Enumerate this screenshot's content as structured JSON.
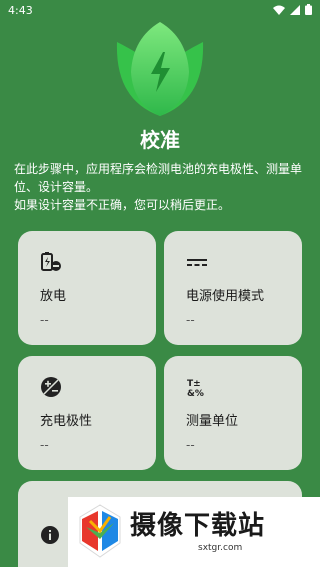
{
  "status_bar": {
    "time": "4:43",
    "icons": [
      "wifi-icon",
      "signal-icon",
      "battery-icon"
    ]
  },
  "app": {
    "logo_icon": "leaf-lightning-icon",
    "title": "校准",
    "description_line1": "在此步骤中，应用程序会检测电池的充电极性、测量单位、设计容量。",
    "description_line2": "如果设计容量不正确，您可以稍后更正。"
  },
  "cards": {
    "discharge": {
      "icon": "battery-minus-icon",
      "label": "放电",
      "value": "--"
    },
    "power_mode": {
      "icon": "dc-power-icon",
      "label": "电源使用模式",
      "value": "--"
    },
    "polarity": {
      "icon": "polarity-icon",
      "label": "充电极性",
      "value": "--"
    },
    "unit": {
      "icon": "unit-symbols-icon",
      "label": "测量单位",
      "value": "--"
    }
  },
  "info_card": {
    "icon": "info-icon"
  },
  "watermark": {
    "title": "摄像下载站",
    "url": "sxtgr.com"
  },
  "colors": {
    "background": "#3a8a45",
    "card": "#dde2da",
    "logo_green": "#4cd44c"
  }
}
